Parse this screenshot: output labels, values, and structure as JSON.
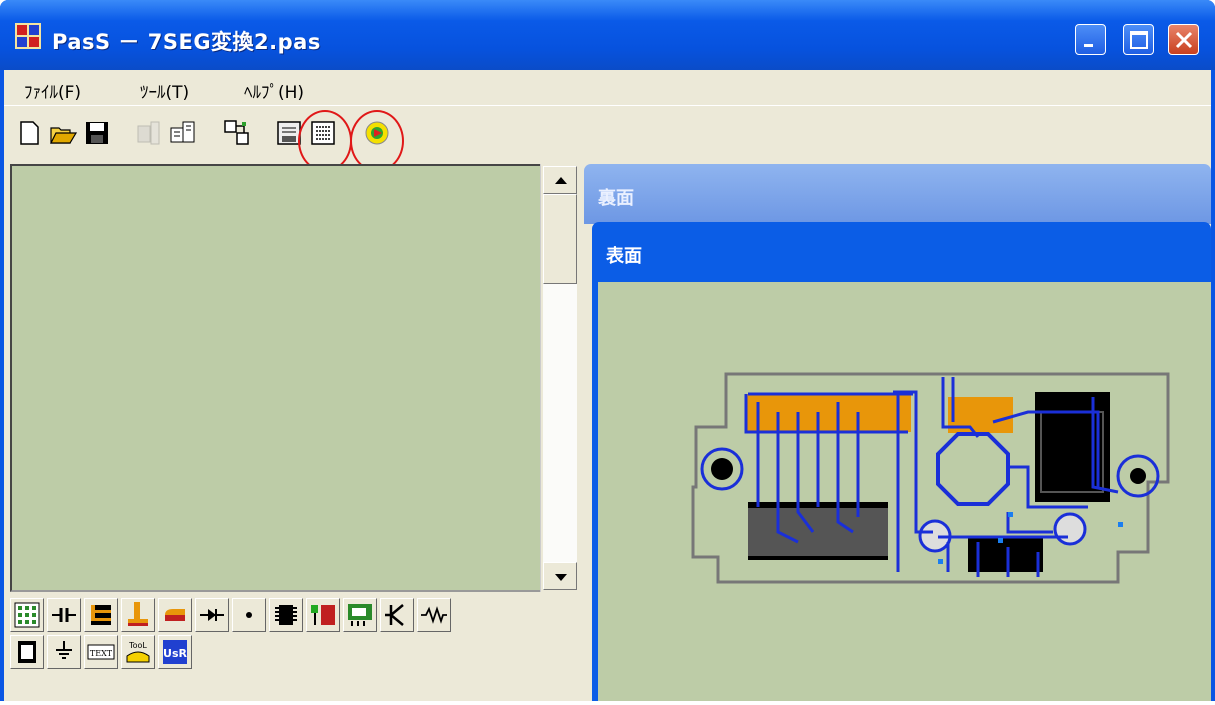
{
  "window": {
    "title": "PasS － 7SEG変換2.pas"
  },
  "menu": [
    {
      "label": "ﾌｧｲﾙ(F)"
    },
    {
      "label": "ﾂｰﾙ(T)"
    },
    {
      "label": "ﾍﾙﾌﾟ(H)"
    }
  ],
  "toolbar": {
    "highlighted": [
      "list-icon",
      "run-icon"
    ],
    "highlight_color": "#e01818"
  },
  "palette": {
    "row2_text_buttons": {
      "text": "TEXT",
      "tool": "TooL",
      "user": "UsR"
    }
  },
  "documents": {
    "back_window_title": "裏面",
    "front_window_title": "表面"
  },
  "colors": {
    "board_background": "#bdcca7",
    "trace": "#1a2fd8",
    "pad": "#e8960a",
    "outline": "#777777"
  }
}
